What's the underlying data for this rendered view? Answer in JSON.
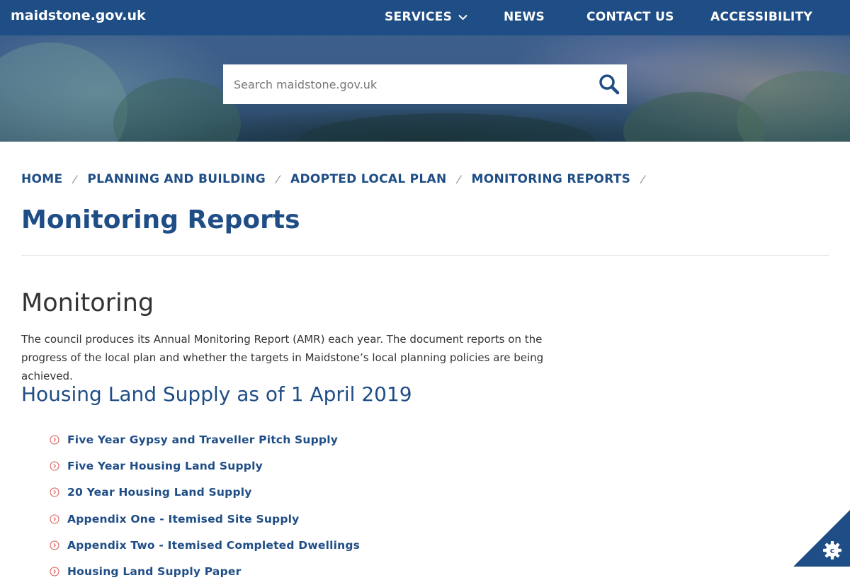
{
  "header": {
    "logo": "maidstone.gov.uk",
    "nav": [
      {
        "label": "SERVICES"
      },
      {
        "label": "NEWS"
      },
      {
        "label": "CONTACT US"
      },
      {
        "label": "ACCESSIBILITY"
      }
    ]
  },
  "search": {
    "placeholder": "Search maidstone.gov.uk",
    "icon": "search-icon"
  },
  "breadcrumb": [
    {
      "label": "HOME"
    },
    {
      "label": "PLANNING AND BUILDING"
    },
    {
      "label": "ADOPTED LOCAL PLAN"
    },
    {
      "label": "MONITORING REPORTS"
    }
  ],
  "page": {
    "title": "Monitoring Reports",
    "section_title": "Monitoring",
    "intro": "The council produces its Annual Monitoring Report (AMR) each year. The document reports on the progress of the local plan and whether the targets in Maidstone’s local planning policies are being achieved.",
    "sub_title": "Housing Land Supply as of 1 April 2019",
    "links": [
      {
        "label": "Five Year Gypsy and Traveller Pitch Supply"
      },
      {
        "label": "Five Year Housing Land Supply"
      },
      {
        "label": "20 Year Housing Land Supply"
      },
      {
        "label": "Appendix One - Itemised Site Supply"
      },
      {
        "label": "Appendix Two - Itemised Completed Dwellings"
      },
      {
        "label": "Housing Land Supply Paper"
      }
    ]
  },
  "colors": {
    "brand": "#1f4d85",
    "cookie_corner": "#1f4d85"
  },
  "cookie": {
    "icon": "cookie-settings-icon"
  }
}
